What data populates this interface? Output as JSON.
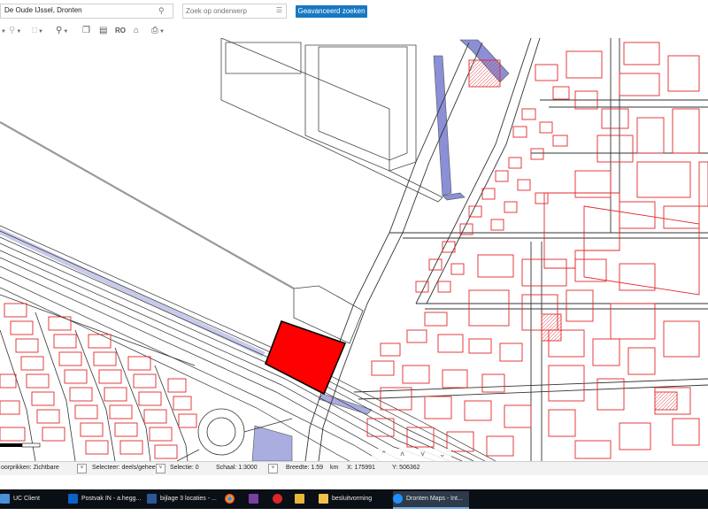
{
  "search": {
    "location_value": "De Oude IJssel, Dronten",
    "object_placeholder": "Zoek op onderwerp",
    "advanced_label": "Geavanceerd zoeken"
  },
  "toolbar": {
    "icons": [
      "pan-icon",
      "marker-icon",
      "document-icon",
      "zoom-icon",
      "copy-icon",
      "list-icon",
      "ro-icon",
      "camera-house-icon",
      "print-icon"
    ],
    "ro_label": "RO"
  },
  "status": {
    "doorprikken_label": "oorprikken: Zichtbare",
    "selecteer_label": "Selecteer: deels/geheel",
    "selectie_label": "Selectie: 0",
    "schaal_label": "Schaal: 1:3000",
    "breedte_label": "Breedte: 1.59",
    "breedte_unit": "km",
    "x_label": "X: 175991",
    "y_label": "Y: 506362"
  },
  "taskbar": {
    "items": [
      {
        "label": "UC Client",
        "icon": "uc-client-icon"
      },
      {
        "label": "Postvak IN - a.hegg...",
        "icon": "outlook-icon"
      },
      {
        "label": "bijlage 3 locaties - ...",
        "icon": "word-icon"
      },
      {
        "label": "",
        "icon": "chrome-icon"
      },
      {
        "label": "",
        "icon": "onenote-icon"
      },
      {
        "label": "",
        "icon": "red-app-icon"
      },
      {
        "label": "",
        "icon": "folder-icon"
      },
      {
        "label": "besluitvorming",
        "icon": "folder-yellow-icon"
      },
      {
        "label": "Dronten Maps - Int...",
        "icon": "ie-icon"
      }
    ]
  },
  "map": {
    "highlight_color": "#ff0000",
    "building_outline_color": "#e0292b",
    "road_color": "#333333",
    "water_color": "#8a8fd6"
  }
}
